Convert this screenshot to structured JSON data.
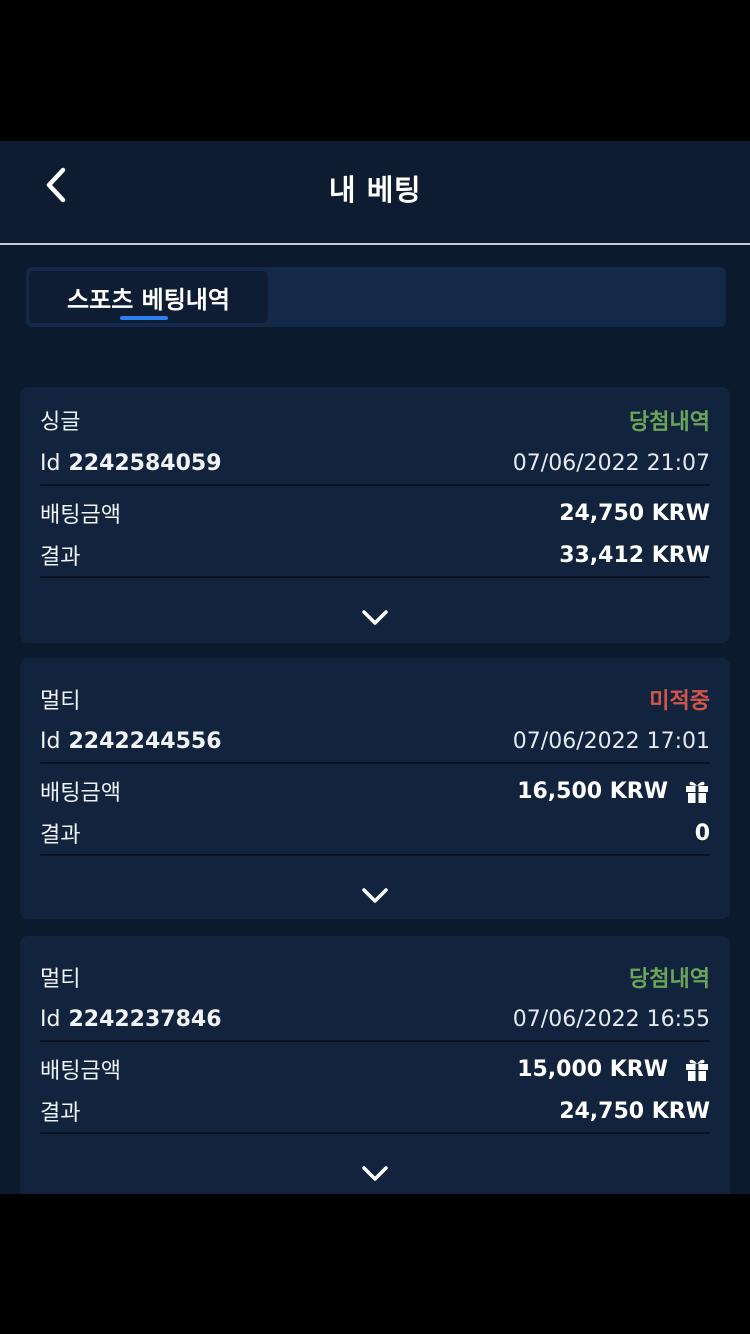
{
  "header": {
    "title": "내 베팅"
  },
  "tabs": [
    {
      "label": "스포츠 베팅내역"
    }
  ],
  "bets": [
    {
      "type": "싱글",
      "status": "당첨내역",
      "status_kind": "won",
      "id_label": "Id",
      "id": "2242584059",
      "date": "07/06/2022 21:07",
      "stake_label": "배팅금액",
      "stake": "24,750 KRW",
      "result_label": "결과",
      "result": "33,412 KRW"
    },
    {
      "type": "멀티",
      "status": "미적중",
      "status_kind": "lost",
      "id_label": "Id",
      "id": "2242244556",
      "date": "07/06/2022 17:01",
      "stake_label": "배팅금액",
      "stake": "16,500 KRW",
      "result_label": "결과",
      "result": "0"
    },
    {
      "type": "멀티",
      "status": "당첨내역",
      "status_kind": "won",
      "id_label": "Id",
      "id": "2242237846",
      "date": "07/06/2022 16:55",
      "stake_label": "배팅금액",
      "stake": "15,000 KRW",
      "result_label": "결과",
      "result": "24,750 KRW"
    }
  ],
  "colors": {
    "background": "#0c1a2e",
    "card": "#12233d",
    "won": "#6aa55a",
    "lost": "#d2574a",
    "accent": "#2f7ef0"
  },
  "icons": {
    "back": "chevron-left-icon",
    "expand": "chevron-down-icon",
    "bonus": "gift-icon"
  }
}
